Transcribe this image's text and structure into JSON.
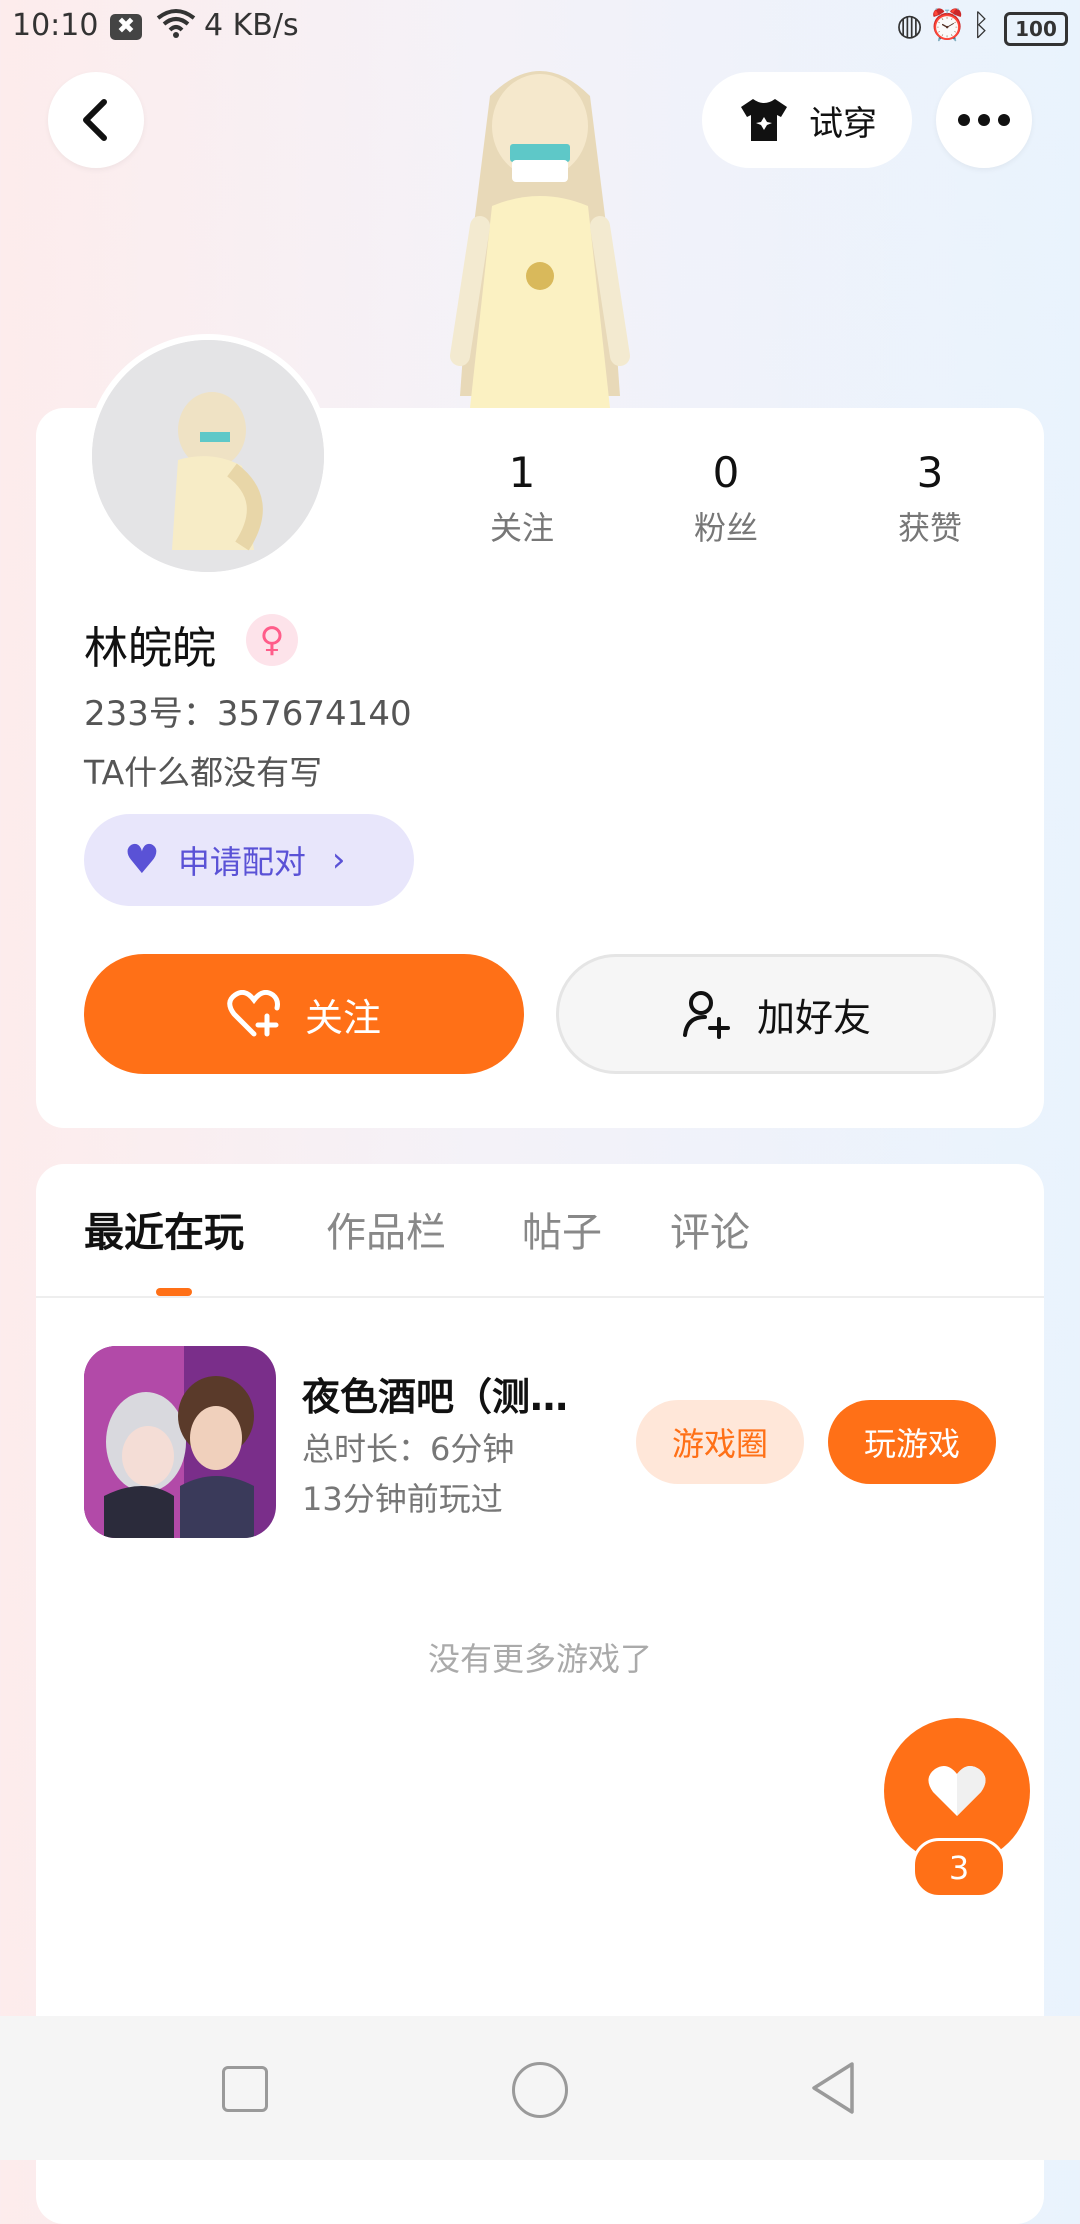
{
  "status_bar": {
    "time": "10:10",
    "notification_icon": "✖",
    "speed": "4 KB/s",
    "battery": "100"
  },
  "header": {
    "try_on_label": "试穿"
  },
  "profile": {
    "stats": [
      {
        "value": "1",
        "label": "关注"
      },
      {
        "value": "0",
        "label": "粉丝"
      },
      {
        "value": "3",
        "label": "获赞"
      }
    ],
    "name": "林皖皖",
    "uid": "233号：357674140",
    "bio": "TA什么都没有写",
    "pair_label": "申请配对",
    "follow_label": "关注",
    "add_friend_label": "加好友"
  },
  "tabs": [
    "最近在玩",
    "作品栏",
    "帖子",
    "评论"
  ],
  "game": {
    "title": "夜色酒吧（测…",
    "duration": "总时长：6分钟",
    "last_played": "13分钟前玩过",
    "circle_label": "游戏圈",
    "play_label": "玩游戏"
  },
  "no_more_text": "没有更多游戏了",
  "like_count": "3",
  "colors": {
    "accent": "#ff7017",
    "pair": "#5a52d6",
    "gender": "#ff5d8a"
  }
}
